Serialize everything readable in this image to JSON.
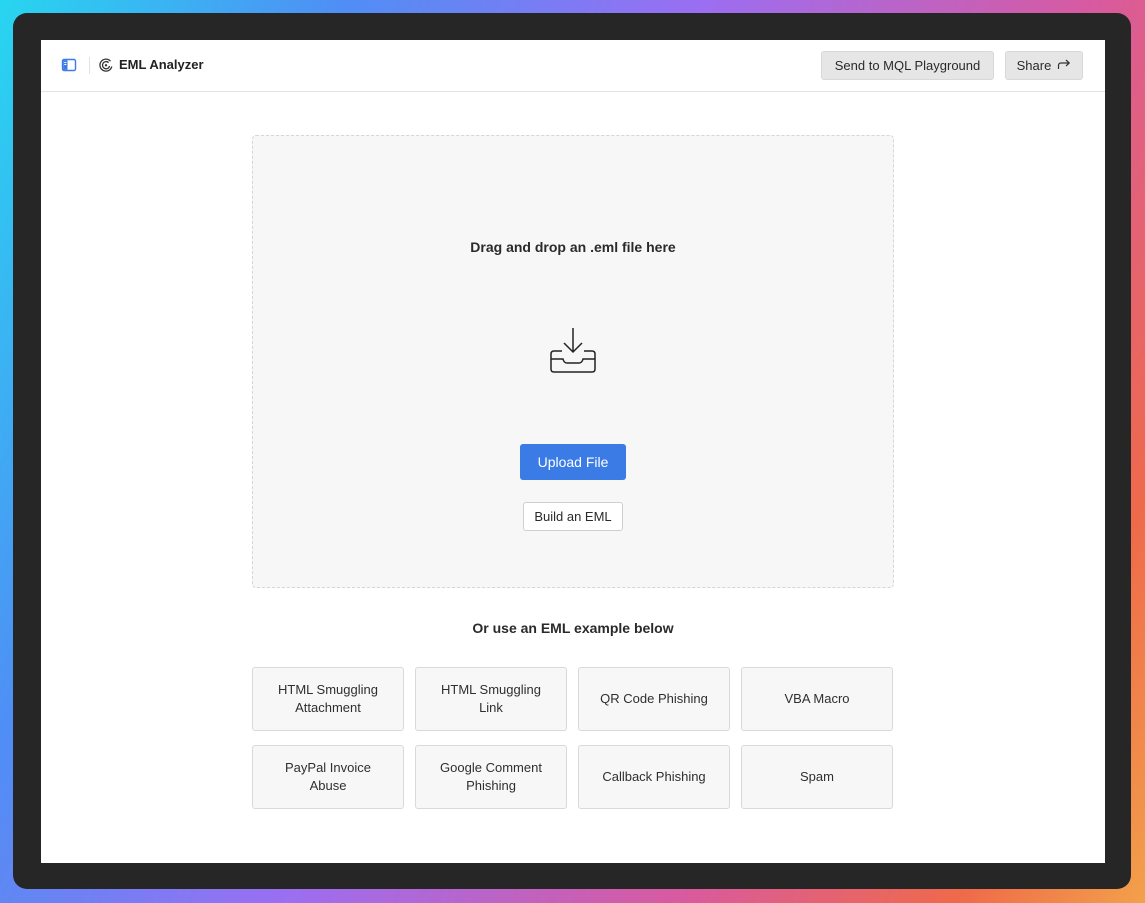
{
  "app": {
    "title": "EML Analyzer"
  },
  "header": {
    "mql_button": "Send to MQL Playground",
    "share_button": "Share"
  },
  "dropzone": {
    "heading": "Drag and drop an .eml file here",
    "upload_button": "Upload File",
    "build_button": "Build an EML"
  },
  "examples": {
    "heading": "Or use an EML example below",
    "items": [
      "HTML Smuggling Attachment",
      "HTML Smuggling Link",
      "QR Code Phishing",
      "VBA Macro",
      "PayPal Invoice Abuse",
      "Google Comment Phishing",
      "Callback Phishing",
      "Spam"
    ]
  },
  "icons": {
    "sidebar_toggle": "sidebar-icon",
    "logo": "logo-icon",
    "share": "share-arrow-icon",
    "download": "download-tray-icon"
  },
  "colors": {
    "accent": "#3a7be5",
    "sidebar_icon": "#3a7be5"
  }
}
